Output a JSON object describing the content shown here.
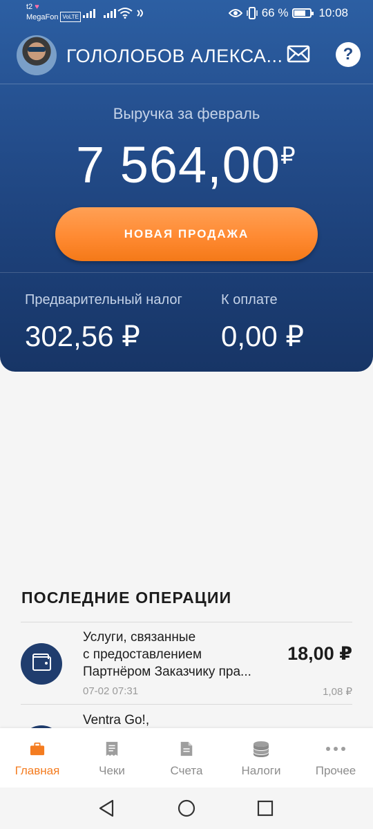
{
  "status_bar": {
    "carrier_top": "t2",
    "carrier_name": "MegaFon",
    "volte": "VoLTE",
    "battery_percent": "66 %",
    "time": "10:08"
  },
  "profile": {
    "name": "ГОЛОЛОБОВ АЛЕКСА..."
  },
  "revenue": {
    "label": "Выручка за февраль",
    "amount": "7 564,00",
    "currency": "₽"
  },
  "actions": {
    "new_sale": "НОВАЯ ПРОДАЖА"
  },
  "stats": [
    {
      "label": "Предварительный налог",
      "value": "302,56 ₽"
    },
    {
      "label": "К оплате",
      "value": "0,00 ₽"
    }
  ],
  "operations": {
    "title": "ПОСЛЕДНИЕ ОПЕРАЦИИ",
    "items": [
      {
        "lines": [
          "Услуги, связанные",
          "с предоставлением",
          "Партнёром Заказчику пра..."
        ],
        "amount": "18,00 ₽",
        "date": "07-02 07:31",
        "tax": "1,08 ₽",
        "icon": "wallet-icon"
      },
      {
        "lines": [
          "Ventra Go!,"
        ],
        "icon": "wallet-icon"
      }
    ]
  },
  "tabs": [
    {
      "label": "Главная",
      "icon": "briefcase-icon",
      "active": true
    },
    {
      "label": "Чеки",
      "icon": "receipt-icon",
      "active": false
    },
    {
      "label": "Счета",
      "icon": "document-icon",
      "active": false
    },
    {
      "label": "Налоги",
      "icon": "coins-icon",
      "active": false
    },
    {
      "label": "Прочее",
      "icon": "more-icon",
      "active": false
    }
  ],
  "colors": {
    "header_top": "#2c5fa3",
    "header_bottom": "#173566",
    "accent_orange": "#f47c20",
    "operation_icon_bg": "#203d6e"
  }
}
